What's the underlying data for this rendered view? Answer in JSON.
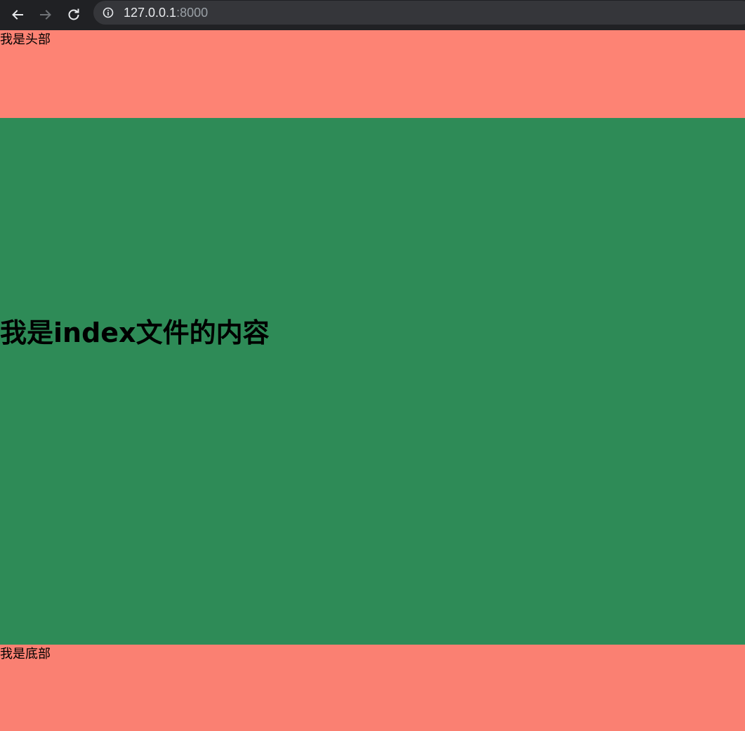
{
  "browser": {
    "url_host": "127.0.0.1",
    "url_port": ":8000",
    "back_icon": "back-arrow-icon",
    "forward_icon": "forward-arrow-icon",
    "reload_icon": "reload-icon",
    "info_icon": "info-icon"
  },
  "page": {
    "header_text": "我是头部",
    "main_heading": "我是index文件的内容",
    "footer_text": "我是底部"
  },
  "colors": {
    "header_bg": "#fd8374",
    "main_bg": "#2e8b57",
    "footer_bg": "#fa8072",
    "browser_chrome": "#202124"
  }
}
